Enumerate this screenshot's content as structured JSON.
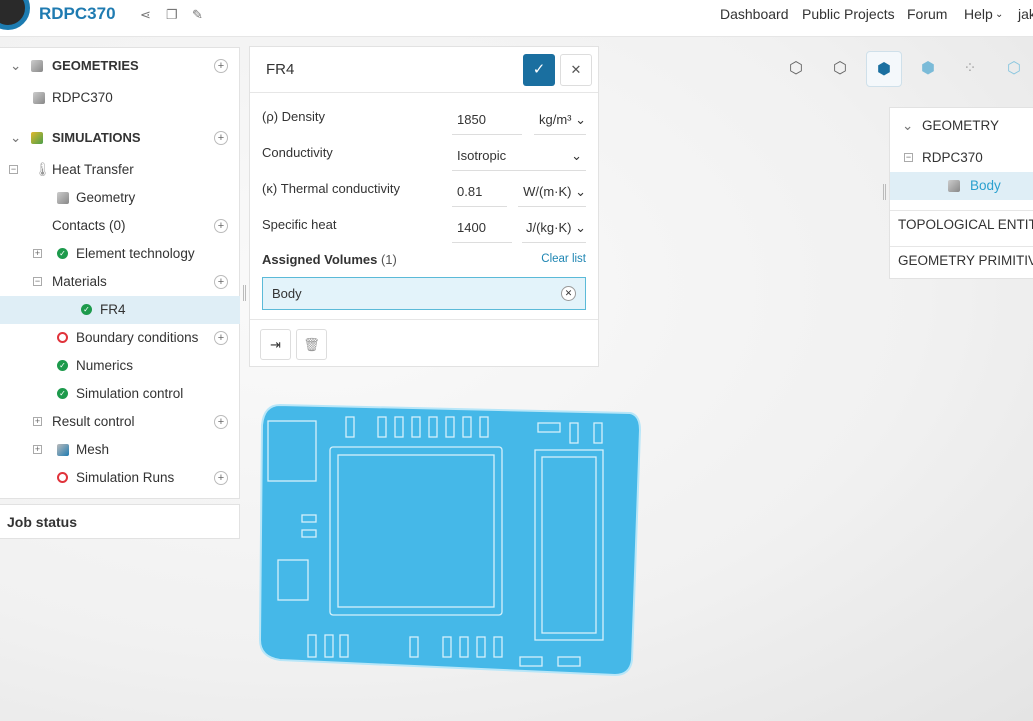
{
  "header": {
    "project": "RDPC370",
    "nav": [
      "Dashboard",
      "Public Projects",
      "Forum",
      "Help"
    ],
    "user": "jak"
  },
  "tree": {
    "geometries": "GEOMETRIES",
    "geometry_item": "RDPC370",
    "simulations": "SIMULATIONS",
    "items": [
      {
        "label": "Heat Transfer",
        "status": "thermometer"
      },
      {
        "label": "Geometry",
        "status": "geometry"
      },
      {
        "label": "Contacts (0)",
        "status": "none"
      },
      {
        "label": "Element technology",
        "status": "ok"
      },
      {
        "label": "Materials",
        "status": "none"
      },
      {
        "label": "FR4",
        "status": "ok"
      },
      {
        "label": "Boundary conditions",
        "status": "error"
      },
      {
        "label": "Numerics",
        "status": "ok"
      },
      {
        "label": "Simulation control",
        "status": "ok"
      },
      {
        "label": "Result control",
        "status": "none"
      },
      {
        "label": "Mesh",
        "status": "mesh"
      },
      {
        "label": "Simulation Runs",
        "status": "error"
      }
    ],
    "job_status": "Job status"
  },
  "dialog": {
    "title": "FR4",
    "fields": [
      {
        "label": "(ρ) Density",
        "value": "1850",
        "unit": "kg/m³"
      },
      {
        "label": "Conductivity",
        "value": "Isotropic",
        "unit": ""
      },
      {
        "label": "(κ) Thermal conductivity",
        "value": "0.81",
        "unit": "W/(m·K)"
      },
      {
        "label": "Specific heat",
        "value": "1400",
        "unit": "J/(kg·K)"
      }
    ],
    "assigned_label": "Assigned Volumes",
    "assigned_count": "(1)",
    "clear": "Clear list",
    "volume": "Body"
  },
  "right": {
    "geometry": "GEOMETRY",
    "item": "RDPC370",
    "body": "Body",
    "topo": "TOPOLOGICAL ENTITY",
    "prim": "GEOMETRY PRIMITIVE"
  },
  "colors": {
    "accent": "#1f7bb1",
    "pcb": "#4ab8e6",
    "ok": "#1d9a4c",
    "error": "#e0333b"
  }
}
